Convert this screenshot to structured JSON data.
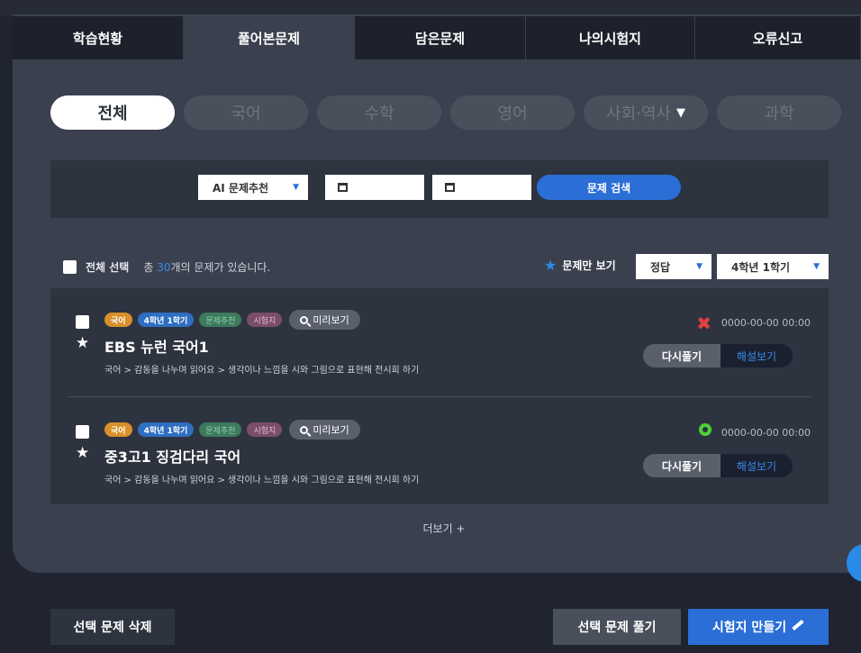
{
  "tabs": [
    {
      "label": "학습현황"
    },
    {
      "label": "풀어본문제"
    },
    {
      "label": "담은문제"
    },
    {
      "label": "나의시험지"
    },
    {
      "label": "오류신고"
    }
  ],
  "subjects": [
    {
      "label": "전체"
    },
    {
      "label": "국어"
    },
    {
      "label": "수학"
    },
    {
      "label": "영어"
    },
    {
      "label": "사회·역사"
    },
    {
      "label": "과학"
    }
  ],
  "search": {
    "type_select": "AI 문제추천",
    "button": "문제 검색"
  },
  "list_header": {
    "select_all": "전체 선택",
    "count_prefix": "총 ",
    "count": "30",
    "count_suffix": "개의 문제가 있습니다.",
    "only_questions": "문제만 보기",
    "answer_filter": "정답",
    "grade_filter": "4학년 1학기"
  },
  "cards": [
    {
      "tags": [
        "국어",
        "4학년 1학기",
        "문제추천",
        "시험지"
      ],
      "preview": "미리보기",
      "title": "EBS 뉴런 국어1",
      "path": "국어 > 감동을 나누며 읽어요 > 생각이나 느낌을 시와 그림으로 표현해 전시회 하기",
      "result": "wrong",
      "date": "0000-00-00 00:00",
      "retry": "다시풀기",
      "explain": "해설보기"
    },
    {
      "tags": [
        "국어",
        "4학년 1학기",
        "문제추천",
        "시험지"
      ],
      "preview": "미리보기",
      "title": "중3고1 징검다리 국어",
      "path": "국어 > 감동을 나누며 읽어요 > 생각이나 느낌을 시와 그림으로 표현해 전시회 하기",
      "result": "correct",
      "date": "0000-00-00 00:00",
      "retry": "다시풀기",
      "explain": "해설보기"
    }
  ],
  "more": "더보기 +",
  "bottom": {
    "delete": "선택 문제 삭제",
    "solve": "선택 문제 풀기",
    "make": "시험지 만들기"
  },
  "colors": {
    "accent": "#2a6ed6",
    "panel": "#3b404f",
    "background": "#1f2430",
    "wrong": "#e8403a",
    "correct": "#4cd137"
  }
}
